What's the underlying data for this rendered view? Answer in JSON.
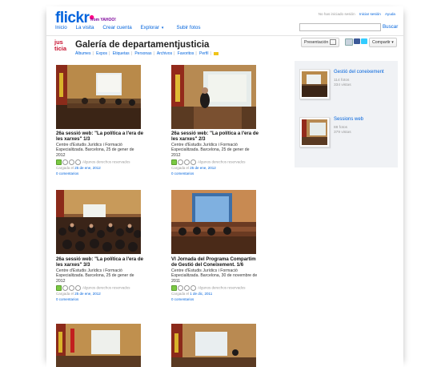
{
  "header": {
    "logo_text": "flickr",
    "logo_sub": "from YAHOO!",
    "nav": [
      "Inicio",
      "La visita",
      "Crear cuenta",
      "Explorar",
      "Subir fotos"
    ],
    "status": "No has iniciado sesión",
    "signin": "Iniciar sesión",
    "help": "Ayuda",
    "search_value": "",
    "search_button": "Buscar"
  },
  "gallery": {
    "badge_line1": "jus",
    "badge_line2": "ticia",
    "title": "Galería de departamentjusticia",
    "subnav": [
      "Álbumes",
      "Expos",
      "Etiquetas",
      "Personas",
      "Archivos",
      "Favoritos",
      "Perfil"
    ],
    "present_label": "Presentación",
    "share_label": "Compartir"
  },
  "photos": [
    {
      "title": "26a sessió web: \"La política a l'era de les xarxes\" 1/3",
      "desc": "Centre d'Estudis Jurídics i Formació Especialitzada. Barcelona, 25 de gener de 2012",
      "license": "Algunos derechos reservados",
      "uploaded_prefix": "Cargada el",
      "uploaded": "25 de ene, 2012",
      "comments": "0 comentarios"
    },
    {
      "title": "26a sessió web: \"La política a l'era de les xarxes\" 2/3",
      "desc": "Centre d'Estudis Jurídics i Formació Especialitzada. Barcelona, 25 de gener de 2012",
      "license": "Algunos derechos reservados",
      "uploaded_prefix": "Cargada el",
      "uploaded": "25 de ene, 2012",
      "comments": "0 comentarios"
    },
    {
      "title": "26a sessió web: \"La política a l'era de les xarxes\" 3/3",
      "desc": "Centre d'Estudis Jurídics i Formació Especialitzada. Barcelona, 25 de gener de 2012",
      "license": "Algunos derechos reservados",
      "uploaded_prefix": "Cargada el",
      "uploaded": "25 de ene, 2012",
      "comments": "0 comentarios"
    },
    {
      "title": "VI Jornada del Programa Compartim de Gestió del Coneixement. 1/6",
      "desc": "Centre d'Estudis Jurídics i Formació Especialitzada. Barcelona, 30 de novembre de 2011",
      "license": "Algunos derechos reservados",
      "uploaded_prefix": "Cargada el",
      "uploaded": "1 de dic, 2011",
      "comments": "0 comentarios"
    }
  ],
  "sets": [
    {
      "title": "Gestió del coneixement",
      "photos": "114 fotos",
      "views": "334 vistas"
    },
    {
      "title": "Sessions web",
      "photos": "88 fotos",
      "views": "379 vistas"
    }
  ],
  "colors": {
    "flickr_blue": "#0063dc",
    "flickr_pink": "#ff0084",
    "link": "#0063dc",
    "sidebar_bg": "#f0f2f5"
  }
}
